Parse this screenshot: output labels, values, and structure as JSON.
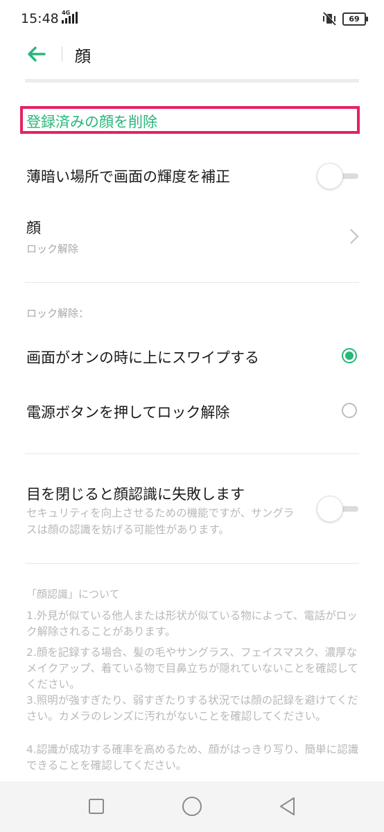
{
  "status_bar": {
    "time": "15:48",
    "network": "4G",
    "battery": "69",
    "icons": [
      "signal-icon",
      "vibrate-off-icon",
      "battery-icon"
    ]
  },
  "header": {
    "title": "顔",
    "back_icon": "back-arrow-icon"
  },
  "items": {
    "delete_face": "登録済みの顔を削除",
    "brighten": {
      "label": "薄暗い場所で画面の輝度を補正",
      "enabled": false
    },
    "face": {
      "label": "顔",
      "sub": "ロック解除"
    },
    "unlock_section": "ロック解除：",
    "unlock_options": [
      {
        "label": "画面がオンの時に上にスワイプする",
        "selected": true
      },
      {
        "label": "電源ボタンを押してロック解除",
        "selected": false
      }
    ],
    "eyes": {
      "label": "目を閉じると顔認識に失敗します",
      "desc": "セキュリティを向上させるための機能ですが、サングラスは顔の認識を妨げる可能性があります。",
      "enabled": false
    }
  },
  "about": {
    "title": "「顔認識」について",
    "notes": [
      "1.外見が似ている他人または形状が似ている物によって、電話がロック解除されることがあります。",
      "2.顔を記録する場合、髪の毛やサングラス、フェイスマスク、濃厚なメイクアップ、着ている物で目鼻立ちが隠れていないことを確認してください。",
      "3.照明が強すぎたり、弱すぎたりする状況では顔の記録を避けてください。カメラのレンズに汚れがないことを確認してください。",
      "4.認識が成功する確率を高めるため、顔がはっきり写り、簡単に認識できることを確認してください。"
    ]
  },
  "colors": {
    "accent": "#29b67a",
    "highlight_border": "#e4225f",
    "secondary_text": "#a8a8a8"
  },
  "nav_bar": [
    "recent-apps-icon",
    "home-icon",
    "back-icon"
  ]
}
